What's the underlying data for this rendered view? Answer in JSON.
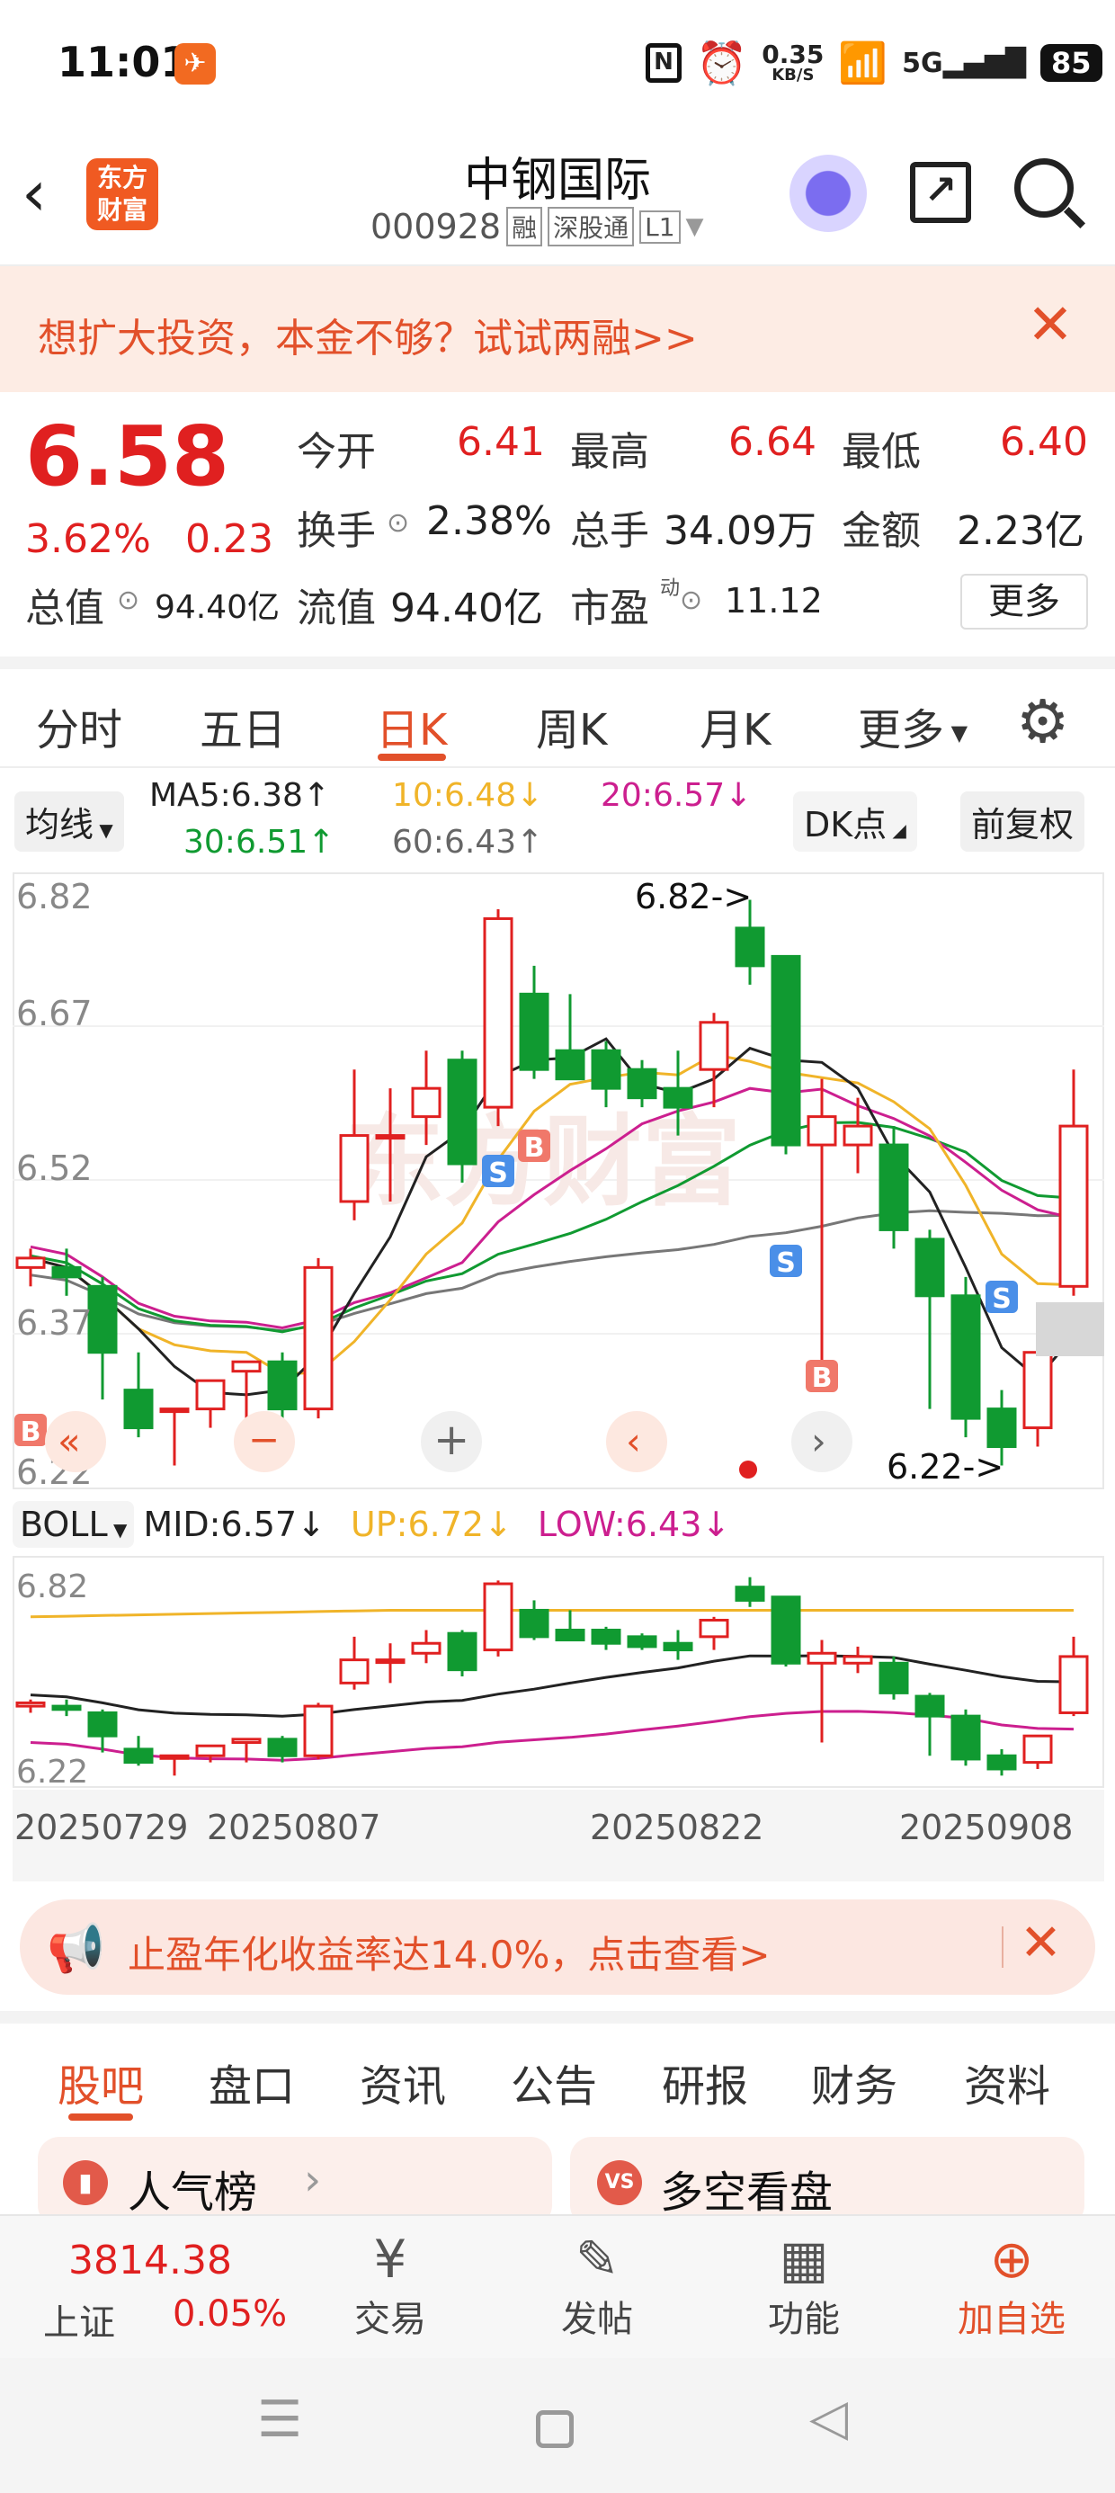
{
  "status": {
    "time": "11:01",
    "speed": "0.35",
    "speed_unit": "KB/S",
    "network": "5G",
    "battery": "85"
  },
  "header": {
    "logo_line1": "东方",
    "logo_line2": "财富",
    "stock_name": "中钢国际",
    "stock_code": "000928",
    "tags": [
      "融",
      "深股通",
      "L1"
    ]
  },
  "banner": {
    "text": "想扩大投资，本金不够？试试两融>>"
  },
  "quote": {
    "price": "6.58",
    "change_pct": "3.62%",
    "change_amt": "0.23",
    "open_label": "今开",
    "open": "6.41",
    "high_label": "最高",
    "high": "6.64",
    "low_label": "最低",
    "low": "6.40",
    "turnover_label": "换手",
    "turnover": "2.38%",
    "volume_label": "总手",
    "volume": "34.09万",
    "amount_label": "金额",
    "amount": "2.23亿",
    "mktcap_label": "总值",
    "mktcap": "94.40亿",
    "float_label": "流值",
    "float_cap": "94.40亿",
    "pe_label": "市盈",
    "pe_sup": "动",
    "pe": "11.12",
    "more": "更多"
  },
  "tabs": [
    "分时",
    "五日",
    "日K",
    "周K",
    "月K",
    "更多"
  ],
  "ma": {
    "selector": "均线",
    "ma5": "MA5:6.38↑",
    "ma10": "10:6.48↓",
    "ma20": "20:6.57↓",
    "ma30": "30:6.51↑",
    "ma60": "60:6.43↑",
    "dk": "DK点",
    "fq": "前复权"
  },
  "chart_data": {
    "type": "candlestick",
    "y_ticks": [
      "6.82",
      "6.67",
      "6.52",
      "6.37",
      "6.22"
    ],
    "annotations": {
      "high": "6.82->",
      "low": "6.22->"
    },
    "markers": [
      "B",
      "S",
      "B",
      "S",
      "B",
      "S"
    ],
    "candles": [
      {
        "o": 6.43,
        "h": 6.45,
        "l": 6.41,
        "c": 6.44
      },
      {
        "o": 6.43,
        "h": 6.45,
        "l": 6.4,
        "c": 6.42
      },
      {
        "o": 6.41,
        "h": 6.42,
        "l": 6.29,
        "c": 6.34
      },
      {
        "o": 6.3,
        "h": 6.34,
        "l": 6.25,
        "c": 6.26
      },
      {
        "o": 6.28,
        "h": 6.28,
        "l": 6.22,
        "c": 6.28
      },
      {
        "o": 6.28,
        "h": 6.31,
        "l": 6.26,
        "c": 6.31
      },
      {
        "o": 6.32,
        "h": 6.33,
        "l": 6.26,
        "c": 6.33
      },
      {
        "o": 6.33,
        "h": 6.34,
        "l": 6.26,
        "c": 6.28
      },
      {
        "o": 6.28,
        "h": 6.44,
        "l": 6.27,
        "c": 6.43
      },
      {
        "o": 6.5,
        "h": 6.64,
        "l": 6.48,
        "c": 6.57
      },
      {
        "o": 6.57,
        "h": 6.62,
        "l": 6.5,
        "c": 6.57
      },
      {
        "o": 6.59,
        "h": 6.66,
        "l": 6.56,
        "c": 6.62
      },
      {
        "o": 6.65,
        "h": 6.66,
        "l": 6.52,
        "c": 6.54
      },
      {
        "o": 6.6,
        "h": 6.81,
        "l": 6.58,
        "c": 6.8
      },
      {
        "o": 6.72,
        "h": 6.75,
        "l": 6.63,
        "c": 6.64
      },
      {
        "o": 6.66,
        "h": 6.72,
        "l": 6.63,
        "c": 6.63
      },
      {
        "o": 6.66,
        "h": 6.67,
        "l": 6.6,
        "c": 6.62
      },
      {
        "o": 6.64,
        "h": 6.65,
        "l": 6.6,
        "c": 6.61
      },
      {
        "o": 6.62,
        "h": 6.66,
        "l": 6.57,
        "c": 6.6
      },
      {
        "o": 6.64,
        "h": 6.7,
        "l": 6.6,
        "c": 6.69
      },
      {
        "o": 6.79,
        "h": 6.82,
        "l": 6.73,
        "c": 6.75
      },
      {
        "o": 6.76,
        "h": 6.76,
        "l": 6.55,
        "c": 6.56
      },
      {
        "o": 6.56,
        "h": 6.63,
        "l": 6.32,
        "c": 6.59
      },
      {
        "o": 6.56,
        "h": 6.61,
        "l": 6.53,
        "c": 6.58
      },
      {
        "o": 6.56,
        "h": 6.58,
        "l": 6.45,
        "c": 6.47
      },
      {
        "o": 6.46,
        "h": 6.47,
        "l": 6.28,
        "c": 6.4
      },
      {
        "o": 6.4,
        "h": 6.42,
        "l": 6.25,
        "c": 6.27
      },
      {
        "o": 6.28,
        "h": 6.3,
        "l": 6.22,
        "c": 6.24
      },
      {
        "o": 6.26,
        "h": 6.34,
        "l": 6.24,
        "c": 6.34
      },
      {
        "o": 6.41,
        "h": 6.64,
        "l": 6.4,
        "c": 6.58
      }
    ],
    "ma_lines": {
      "MA5": "#222222",
      "MA10": "#f0b429",
      "MA20": "#cc1f8f",
      "MA30": "#109a31",
      "MA60": "#777777"
    }
  },
  "boll": {
    "label": "BOLL",
    "mid": "MID:6.57↓",
    "up": "UP:6.72↓",
    "low": "LOW:6.43↓",
    "y_top": "6.82",
    "y_bottom": "6.22",
    "dates": [
      "20250729",
      "20250807",
      "20250822",
      "20250908"
    ]
  },
  "promo": {
    "text": "止盈年化收益率达14.0%，点击查看>"
  },
  "subtabs": [
    "股吧",
    "盘口",
    "资讯",
    "公告",
    "研报",
    "财务",
    "资料"
  ],
  "cards": {
    "left": "人气榜",
    "right": "多空看盘",
    "right_badge": "VS"
  },
  "bottom": {
    "index_value": "3814.38",
    "index_name": "上证",
    "index_change": "0.05%",
    "items": [
      "交易",
      "发帖",
      "功能",
      "加自选"
    ]
  }
}
